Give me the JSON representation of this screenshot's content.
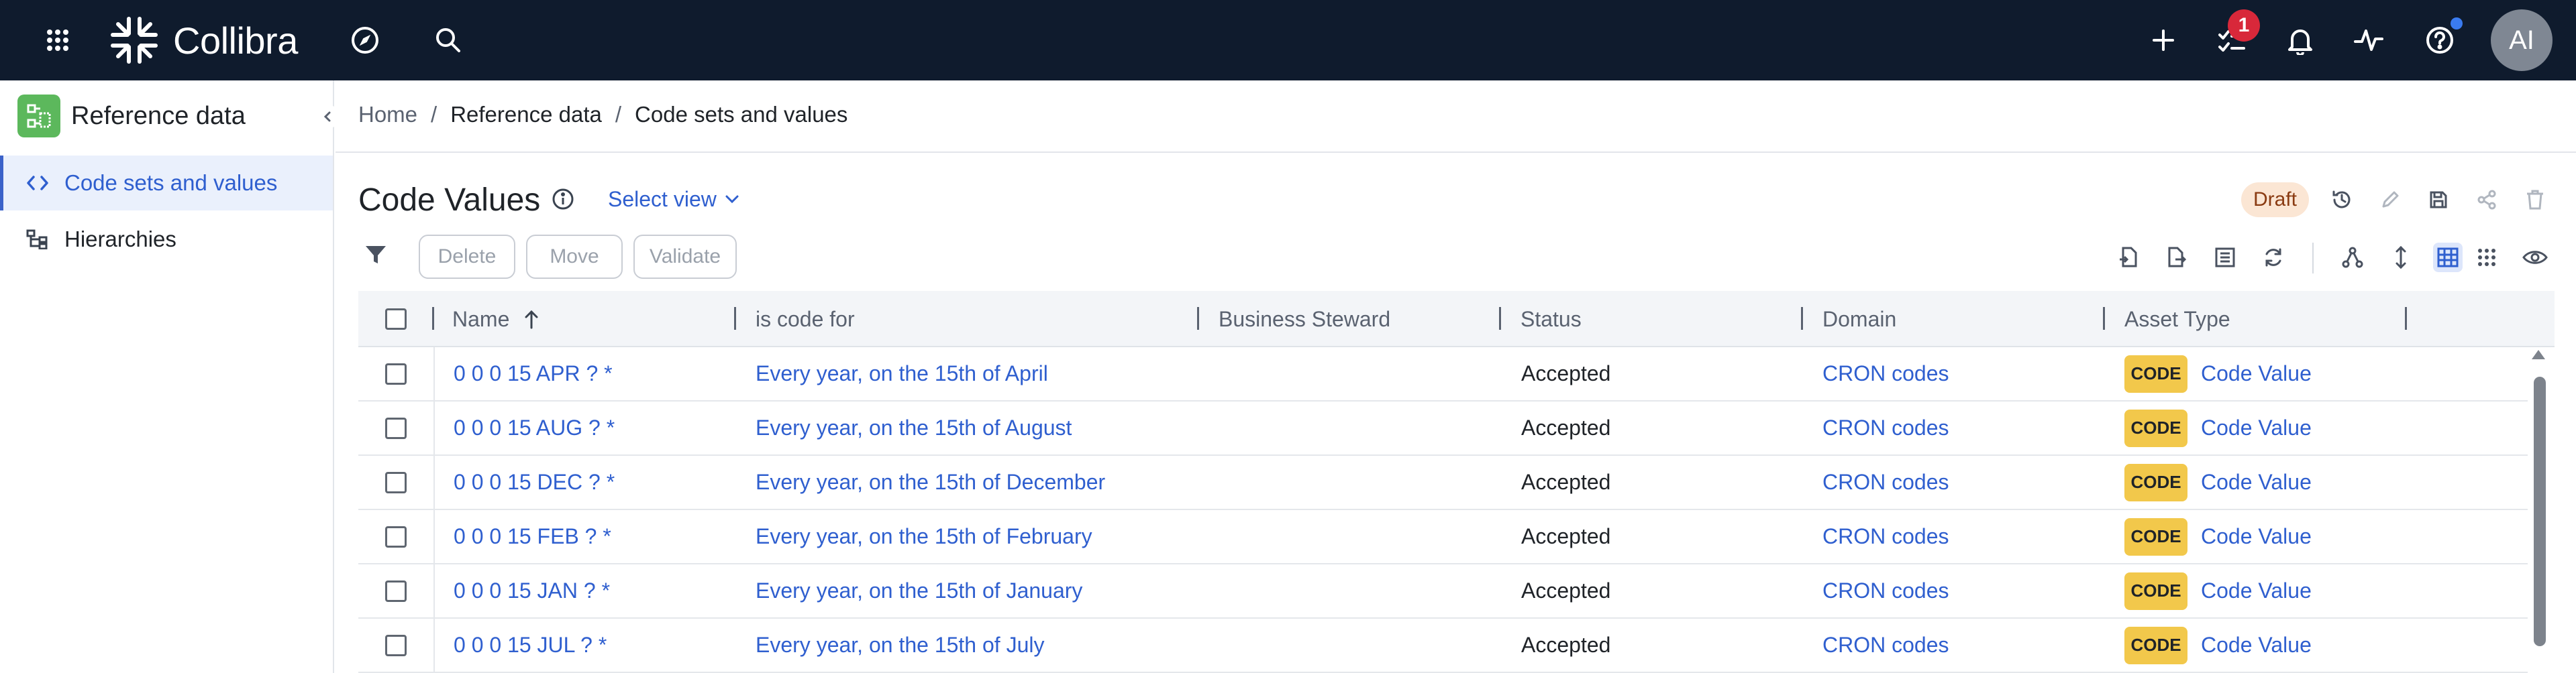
{
  "app": {
    "brand": "Collibra",
    "notification_count": "1",
    "user_initials": "AI"
  },
  "icons": {
    "apps": "grid-icon",
    "explore": "compass-icon",
    "search": "search-icon",
    "add": "plus-icon",
    "tasks": "tasks-icon",
    "notifications": "bell-icon",
    "activity": "activity-icon",
    "help": "help-icon"
  },
  "sidebar": {
    "title": "Reference data",
    "items": [
      {
        "label": "Code sets and values",
        "icon": "code-icon",
        "active": true
      },
      {
        "label": "Hierarchies",
        "icon": "hierarchy-icon",
        "active": false
      }
    ]
  },
  "breadcrumb": [
    "Home",
    "Reference data",
    "Code sets and values"
  ],
  "page": {
    "title": "Code Values",
    "select_view": "Select view",
    "status": "Draft"
  },
  "toolbar": {
    "delete": "Delete",
    "move": "Move",
    "validate": "Validate"
  },
  "table": {
    "columns": [
      "Name",
      "is code for",
      "Business Steward",
      "Status",
      "Domain",
      "Asset Type"
    ],
    "sort": {
      "column": "Name",
      "direction": "ascending"
    },
    "asset_badge": "CODE",
    "rows": [
      {
        "name": "0 0 0 15 APR ? *",
        "code_for": "Every year, on the 15th of April",
        "steward": "",
        "status": "Accepted",
        "domain": "CRON codes",
        "asset_type": "Code Value"
      },
      {
        "name": "0 0 0 15 AUG ? *",
        "code_for": "Every year, on the 15th of August",
        "steward": "",
        "status": "Accepted",
        "domain": "CRON codes",
        "asset_type": "Code Value"
      },
      {
        "name": "0 0 0 15 DEC ? *",
        "code_for": "Every year, on the 15th of December",
        "steward": "",
        "status": "Accepted",
        "domain": "CRON codes",
        "asset_type": "Code Value"
      },
      {
        "name": "0 0 0 15 FEB ? *",
        "code_for": "Every year, on the 15th of February",
        "steward": "",
        "status": "Accepted",
        "domain": "CRON codes",
        "asset_type": "Code Value"
      },
      {
        "name": "0 0 0 15 JAN ? *",
        "code_for": "Every year, on the 15th of January",
        "steward": "",
        "status": "Accepted",
        "domain": "CRON codes",
        "asset_type": "Code Value"
      },
      {
        "name": "0 0 0 15 JUL ? *",
        "code_for": "Every year, on the 15th of July",
        "steward": "",
        "status": "Accepted",
        "domain": "CRON codes",
        "asset_type": "Code Value"
      }
    ]
  },
  "colors": {
    "topbar": "#0f1b2d",
    "accent": "#2f5fcf",
    "code_badge": "#f2c84b",
    "draft_badge": "#fbe6d4",
    "notification": "#d8283a",
    "sidebar_logo": "#5cb85c"
  }
}
